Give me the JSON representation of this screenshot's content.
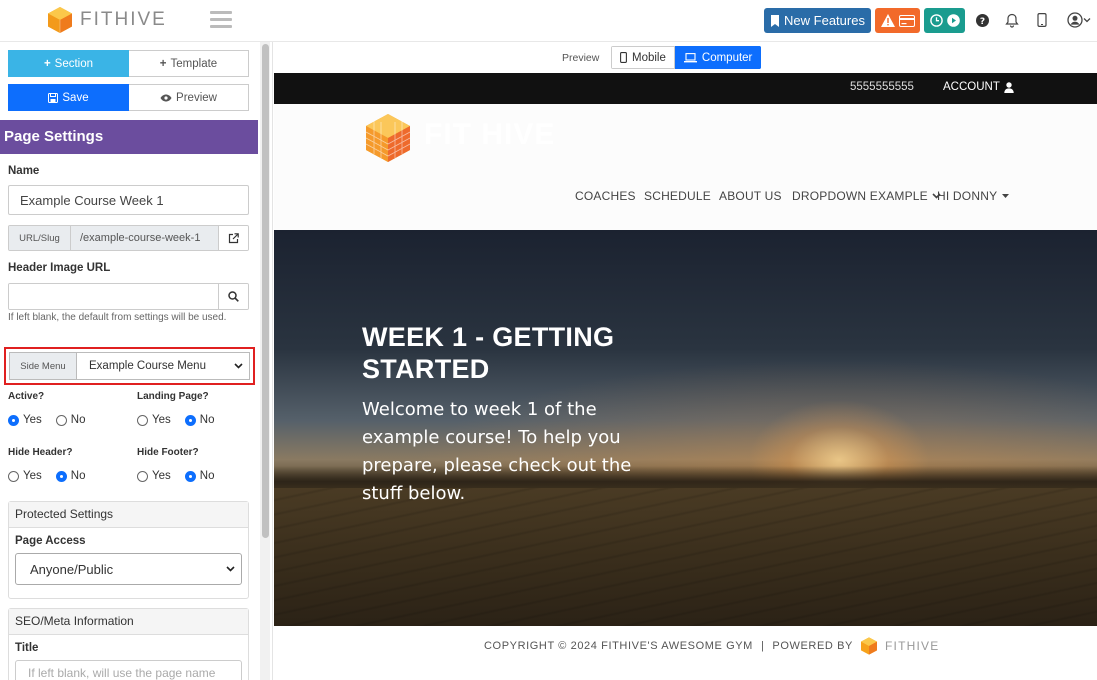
{
  "app": {
    "brand": "FITHIVE"
  },
  "topbar": {
    "new_features_label": "New Features",
    "alert_icon": "warning-icon",
    "card_icon": "credit-card-icon",
    "timer_icon": "clock-icon",
    "play_icon": "play-icon",
    "help_icon": "question-icon",
    "bell_icon": "bell-icon",
    "mobile_icon": "mobile-icon",
    "user_icon": "user-circle-icon",
    "colors": {
      "features": "#2a6ca8",
      "alert": "#f26a2a",
      "timer": "#1a9c8f"
    }
  },
  "sidebar": {
    "section_label": "Section",
    "template_label": "Template",
    "save_label": "Save",
    "preview_label": "Preview",
    "settings_title": "Page Settings",
    "name_label": "Name",
    "name_value": "Example Course Week 1",
    "slug_addon": "URL/Slug",
    "slug_value": "/example-course-week-1",
    "header_image_label": "Header Image URL",
    "header_image_value": "",
    "header_image_hint": "If left blank, the default from settings will be used.",
    "side_menu_addon": "Side Menu",
    "side_menu_value": "Example Course Menu",
    "active_label": "Active?",
    "landing_label": "Landing Page?",
    "hide_header_label": "Hide Header?",
    "hide_footer_label": "Hide Footer?",
    "yes": "Yes",
    "no": "No",
    "active": "Yes",
    "landing": "No",
    "hide_header": "No",
    "hide_footer": "No",
    "protected_title": "Protected Settings",
    "page_access_label": "Page Access",
    "page_access_value": "Anyone/Public",
    "seo_title": "SEO/Meta Information",
    "seo_title_label": "Title",
    "seo_title_placeholder": "If left blank, will use the page name"
  },
  "preview": {
    "label": "Preview",
    "mobile_label": "Mobile",
    "computer_label": "Computer",
    "selected": "Computer"
  },
  "site": {
    "phone": "5555555555",
    "account_label": "ACCOUNT",
    "logo_text": "FIT HIVE",
    "nav": [
      "COACHES",
      "SCHEDULE",
      "ABOUT US",
      "DROPDOWN EXAMPLE",
      "HI DONNY"
    ],
    "hero_title": "WEEK 1 - GETTING STARTED",
    "hero_text": "Welcome to week 1 of the example course! To help you prepare, please check out the stuff below.",
    "footer_copyright": "COPYRIGHT © 2024 FITHIVE'S AWESOME GYM",
    "footer_separator": "|",
    "footer_powered": "POWERED BY",
    "footer_brand": "FITHIVE"
  }
}
